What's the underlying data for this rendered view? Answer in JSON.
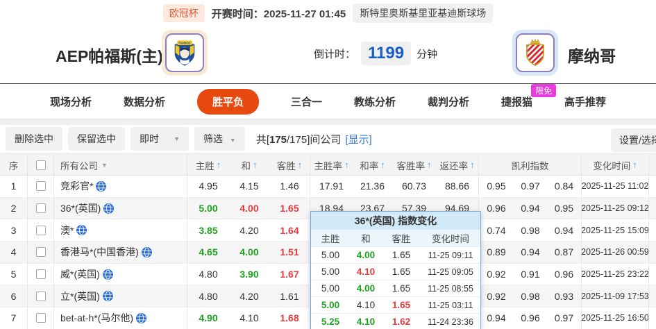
{
  "colors": {
    "accent_orange": "#e8490f",
    "up_green": "#1fa31f",
    "down_red": "#e43b3c",
    "link_blue": "#3a7bd5",
    "badge_magenta": "#ea3ae0",
    "countdown_blue": "#1a5dc8"
  },
  "icons": {
    "sort_asc": "↑",
    "dropdown": "▼"
  },
  "top_bar": {
    "league": "欧冠杯",
    "kickoff_label": "开赛时间：",
    "kickoff_time": "2025-11-27 01:45",
    "venue": "斯特里奥斯基里亚基迪斯球场"
  },
  "match": {
    "home_team": "AEP帕福斯(主)",
    "away_team": "摩纳哥",
    "countdown_label": "倒计时：",
    "countdown_value": "1199",
    "countdown_unit": "分钟"
  },
  "nav": {
    "tabs": [
      {
        "label": "现场分析",
        "active": false
      },
      {
        "label": "数据分析",
        "active": false
      },
      {
        "label": "胜平负",
        "active": true
      },
      {
        "label": "三合一",
        "active": false
      },
      {
        "label": "教练分析",
        "active": false
      },
      {
        "label": "裁判分析",
        "active": false
      },
      {
        "label": "捷报猫",
        "active": false,
        "badge": "限免"
      },
      {
        "label": "高手推荐",
        "active": false
      }
    ]
  },
  "toolbar": {
    "delete_selected": "删除选中",
    "keep_selected": "保留选中",
    "time_mode": "即时",
    "filter_label": "筛选",
    "count_prefix": "共[",
    "count_bold": "175",
    "count_rest": "/175]间公司",
    "show_link": "[显示]",
    "settings_label": "设置/选择"
  },
  "table": {
    "headers": {
      "index": "序",
      "company": "所有公司",
      "home": "主胜",
      "draw": "和",
      "away": "客胜",
      "home_rate": "主胜率",
      "draw_rate": "和率",
      "away_rate": "客胜率",
      "return_rate": "返还率",
      "kelly": "凯利指数",
      "time": "变化时间"
    },
    "rows": [
      {
        "index": "1",
        "company": "竞彩官*",
        "odds": [
          {
            "v": "4.95",
            "c": "k"
          },
          {
            "v": "4.15",
            "c": "k"
          },
          {
            "v": "1.46",
            "c": "k"
          }
        ],
        "rates": [
          "17.91",
          "21.36",
          "60.73",
          "88.66"
        ],
        "kelly": [
          "0.95",
          "0.97",
          "0.84"
        ],
        "time": "2025-11-25 11:02"
      },
      {
        "index": "2",
        "company": "36*(英国)",
        "odds": [
          {
            "v": "5.00",
            "c": "g"
          },
          {
            "v": "4.00",
            "c": "r"
          },
          {
            "v": "1.65",
            "c": "r"
          }
        ],
        "rates": [
          "18.94",
          "23.67",
          "57.39",
          "94.69"
        ],
        "kelly": [
          "0.96",
          "0.94",
          "0.95"
        ],
        "time": "2025-11-25 09:12"
      },
      {
        "index": "3",
        "company": "澳*",
        "odds": [
          {
            "v": "3.85",
            "c": "g"
          },
          {
            "v": "4.20",
            "c": "k"
          },
          {
            "v": "1.64",
            "c": "r"
          }
        ],
        "rates": [
          "",
          "",
          "",
          ""
        ],
        "kelly": [
          "0.74",
          "0.98",
          "0.94"
        ],
        "time": "2025-11-25 15:09"
      },
      {
        "index": "4",
        "company": "香港马*(中国香港)",
        "odds": [
          {
            "v": "4.65",
            "c": "g"
          },
          {
            "v": "4.00",
            "c": "g"
          },
          {
            "v": "1.51",
            "c": "r"
          }
        ],
        "rates": [
          "",
          "",
          "",
          ""
        ],
        "kelly": [
          "0.89",
          "0.94",
          "0.87"
        ],
        "time": "2025-11-26 00:59"
      },
      {
        "index": "5",
        "company": "威*(英国)",
        "odds": [
          {
            "v": "4.80",
            "c": "k"
          },
          {
            "v": "3.90",
            "c": "g"
          },
          {
            "v": "1.67",
            "c": "r"
          }
        ],
        "rates": [
          "",
          "",
          "",
          ""
        ],
        "kelly": [
          "0.92",
          "0.91",
          "0.96"
        ],
        "time": "2025-11-25 23:22"
      },
      {
        "index": "6",
        "company": "立*(英国)",
        "odds": [
          {
            "v": "4.80",
            "c": "k"
          },
          {
            "v": "4.20",
            "c": "k"
          },
          {
            "v": "1.61",
            "c": "k"
          }
        ],
        "rates": [
          "",
          "",
          "",
          ""
        ],
        "kelly": [
          "0.92",
          "0.98",
          "0.93"
        ],
        "time": "2025-11-09 17:53"
      },
      {
        "index": "7",
        "company": "bet-at-h*(马尔他)",
        "odds": [
          {
            "v": "4.90",
            "c": "g"
          },
          {
            "v": "4.10",
            "c": "k"
          },
          {
            "v": "1.68",
            "c": "r"
          }
        ],
        "rates": [
          "",
          "",
          "",
          ""
        ],
        "kelly": [
          "0.94",
          "0.96",
          "0.97"
        ],
        "time": "2025-11-25 16:50"
      }
    ]
  },
  "popup": {
    "title": "36*(英国) 指数变化",
    "headers": {
      "home": "主胜",
      "draw": "和",
      "away": "客胜",
      "time": "变化时间"
    },
    "rows": [
      {
        "home": {
          "v": "5.00",
          "c": "k"
        },
        "draw": {
          "v": "4.00",
          "c": "g"
        },
        "away": {
          "v": "1.65",
          "c": "k"
        },
        "time": "11-25 09:11"
      },
      {
        "home": {
          "v": "5.00",
          "c": "k"
        },
        "draw": {
          "v": "4.10",
          "c": "r"
        },
        "away": {
          "v": "1.65",
          "c": "k"
        },
        "time": "11-25 09:05"
      },
      {
        "home": {
          "v": "5.00",
          "c": "k"
        },
        "draw": {
          "v": "4.00",
          "c": "g"
        },
        "away": {
          "v": "1.65",
          "c": "k"
        },
        "time": "11-25 08:55"
      },
      {
        "home": {
          "v": "5.00",
          "c": "g"
        },
        "draw": {
          "v": "4.10",
          "c": "k"
        },
        "away": {
          "v": "1.65",
          "c": "r"
        },
        "time": "11-25 03:11"
      },
      {
        "home": {
          "v": "5.25",
          "c": "g"
        },
        "draw": {
          "v": "4.10",
          "c": "g"
        },
        "away": {
          "v": "1.62",
          "c": "r"
        },
        "time": "11-24 23:36"
      }
    ]
  }
}
